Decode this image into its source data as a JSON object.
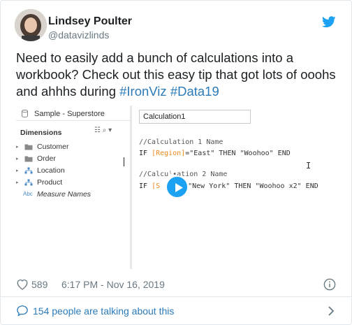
{
  "author": {
    "name": "Lindsey Poulter",
    "handle": "@datavizlinds"
  },
  "tweet": {
    "text_before": "Need to easily add a bunch of calculations into a workbook? Check out this easy tip that got lots of ooohs and ahhhs during ",
    "hashtag_1": "#IronViz",
    "hashtag_2": "#Data19"
  },
  "media": {
    "datasource": "Sample - Superstore",
    "dimensions_title": "Dimensions",
    "fields": [
      {
        "label": "Customer",
        "icon": "folder-icon"
      },
      {
        "label": "Order",
        "icon": "folder-icon"
      },
      {
        "label": "Location",
        "icon": "hierarchy-icon"
      },
      {
        "label": "Product",
        "icon": "hierarchy-icon"
      },
      {
        "label": "Measure Names",
        "icon": "abc-icon",
        "prefix": "Abc"
      }
    ],
    "calc_name": "Calculation1",
    "code": {
      "comment_1": "//Calculation 1 Name",
      "line_1_if": "IF ",
      "line_1_field": "[Region]",
      "line_1_rest": "=\"East\" THEN \"Woohoo\" END",
      "comment_2": "//Calcuˡ∙ation 2 Name",
      "line_2_if": "IF ",
      "line_2_field": "[S",
      "line_2_rest": "\"New York\" THEN \"Woohoo x2\" END"
    }
  },
  "meta": {
    "likes": "589",
    "timestamp": "6:17 PM - Nov 16, 2019"
  },
  "talking": "154 people are talking about this",
  "colors": {
    "accent": "#1da1f2",
    "link": "#2b7bb9",
    "secondary": "#697882",
    "field_orange": "#f08a1d"
  }
}
